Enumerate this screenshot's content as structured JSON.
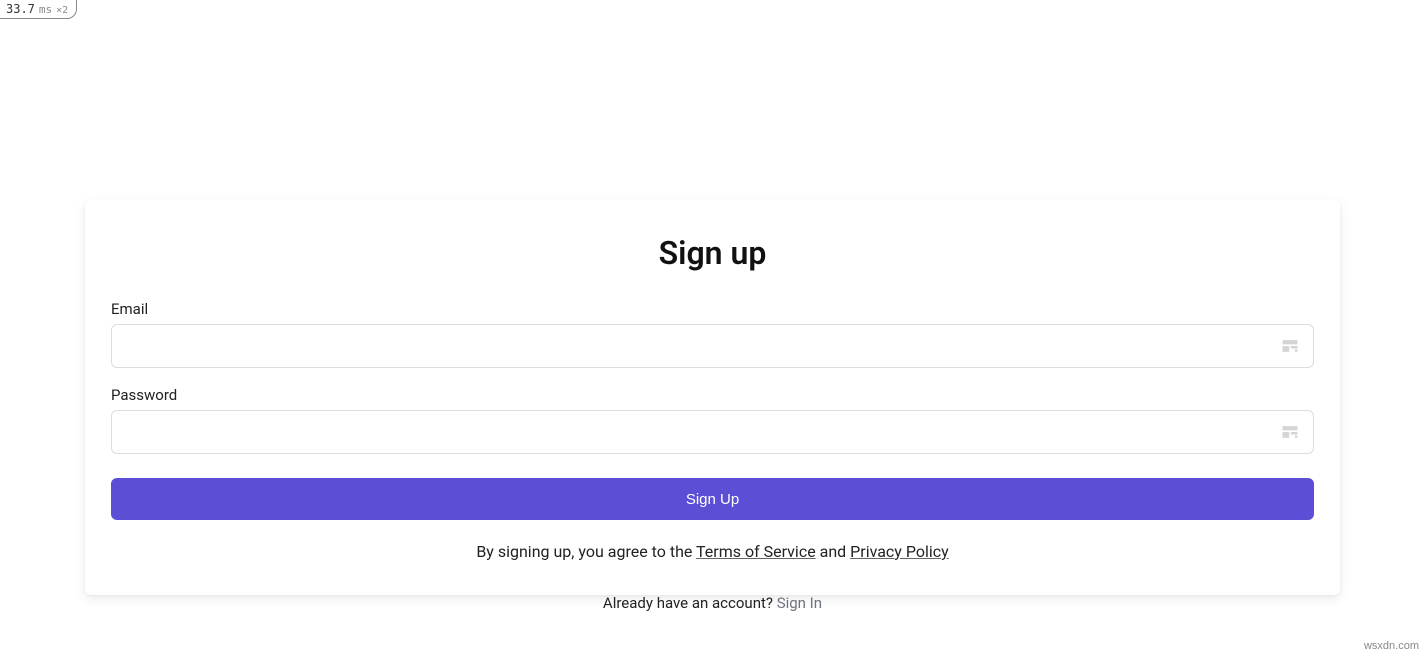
{
  "perf": {
    "value": "33.7",
    "unit": "ms",
    "mult": "×2"
  },
  "card": {
    "title": "Sign up",
    "email_label": "Email",
    "password_label": "Password",
    "submit_label": "Sign Up",
    "agree_prefix": "By signing up, you agree to the ",
    "tos": "Terms of Service",
    "agree_joiner": " and ",
    "privacy": "Privacy Policy"
  },
  "below": {
    "prompt": "Already have an account? ",
    "signin": "Sign In"
  },
  "watermark": "wsxdn.com"
}
